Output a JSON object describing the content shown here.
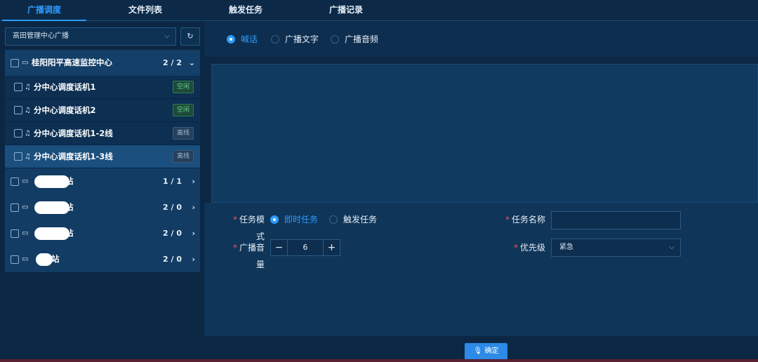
{
  "tabs": [
    {
      "label": "广播调度",
      "active": true
    },
    {
      "label": "文件列表",
      "active": false
    },
    {
      "label": "触发任务",
      "active": false
    },
    {
      "label": "广播记录",
      "active": false
    }
  ],
  "left": {
    "select_value": "高田管理中心广播",
    "group": {
      "label": "桂阳阳平高速监控中心",
      "count": "2 / 2"
    },
    "devices": [
      {
        "label": "分中心调度话机1",
        "status": "空闲",
        "state": "idle"
      },
      {
        "label": "分中心调度话机2",
        "status": "空闲",
        "state": "idle"
      },
      {
        "label": "分中心调度话机1-2线",
        "status": "离线",
        "state": "offline"
      },
      {
        "label": "分中心调度话机1-3线",
        "status": "离线",
        "state": "offline",
        "selected": true
      }
    ],
    "sites": [
      {
        "suffix": "站",
        "count": "1 / 1"
      },
      {
        "suffix": "站",
        "count": "2 / 0"
      },
      {
        "suffix": "站",
        "count": "2 / 0"
      },
      {
        "suffix": "站",
        "count": "2 / 0"
      }
    ]
  },
  "right": {
    "modes": [
      {
        "label": "喊话",
        "selected": true
      },
      {
        "label": "广播文字",
        "selected": false
      },
      {
        "label": "广播音频",
        "selected": false
      }
    ],
    "form": {
      "task_mode_label": "任务模式",
      "task_mode_options": [
        {
          "label": "即时任务",
          "selected": true
        },
        {
          "label": "触发任务",
          "selected": false
        }
      ],
      "task_name_label": "任务名称",
      "task_name_value": "",
      "volume_label": "广播音量",
      "volume_value": "6",
      "minus": "−",
      "plus": "+",
      "priority_label": "优先级",
      "priority_value": "紧急",
      "required_mark": "*"
    },
    "confirm_label": "确定"
  },
  "colors": {
    "accent": "#2e9bff",
    "idle": "#68d08a",
    "offline": "#9fb3c8",
    "required": "#ff4d4f"
  }
}
